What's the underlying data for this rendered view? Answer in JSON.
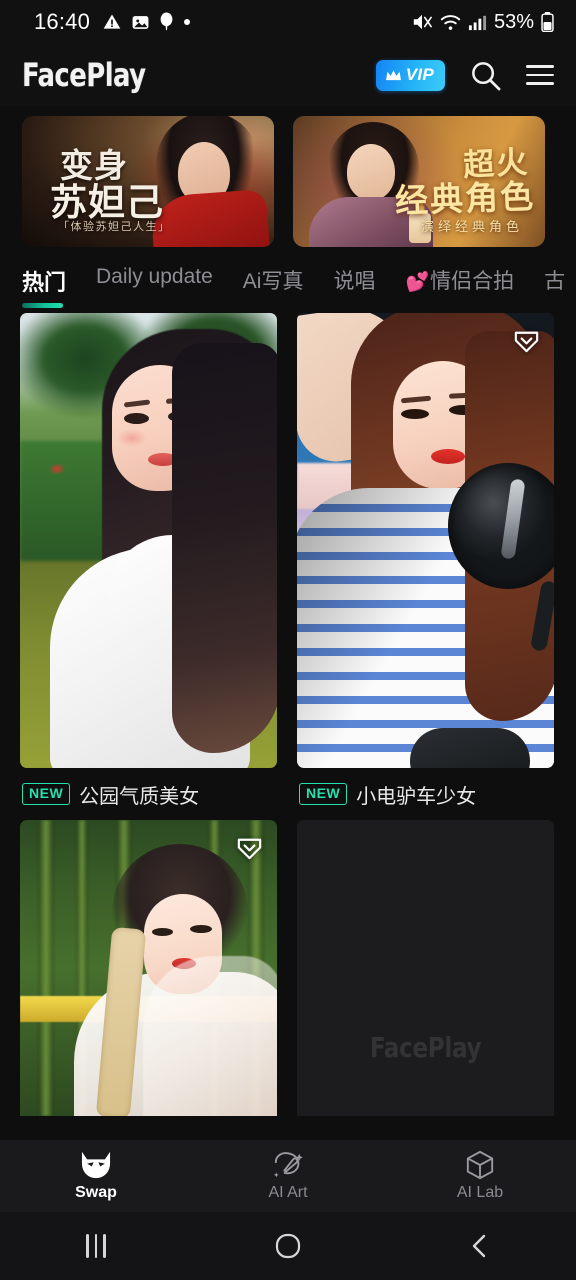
{
  "status_bar": {
    "clock": "16:40",
    "left_icons": [
      "warning-triangle-icon",
      "image-icon",
      "balloon-icon",
      "dot-icon"
    ],
    "right_icons": [
      "mute-icon",
      "wifi-icon",
      "cellular-signal-icon"
    ],
    "battery_percent": "53%"
  },
  "header": {
    "logo": "FacePlay",
    "vip_label": "VIP",
    "icons": [
      "crown-icon",
      "search-icon",
      "hamburger-menu-icon"
    ]
  },
  "banners": [
    {
      "title_line1": "变身",
      "title_line2": "苏妲己",
      "subtitle": "「体验苏妲己人生」"
    },
    {
      "title_line1": "超火",
      "title_line2": "经典角色",
      "subtitle": "演绎经典角色"
    }
  ],
  "tabs": [
    {
      "label": "热门",
      "active": true
    },
    {
      "label": "Daily update",
      "active": false
    },
    {
      "label": "Ai写真",
      "active": false
    },
    {
      "label": "说唱",
      "active": false
    },
    {
      "emoji": "💕",
      "label": "情侣合拍",
      "active": false
    },
    {
      "label": "古",
      "active": false
    }
  ],
  "cards": [
    {
      "badge": "NEW",
      "title": "公园气质美女",
      "favorited": false,
      "favorite_icon": ""
    },
    {
      "badge": "NEW",
      "title": "小电驴车少女",
      "favorited": false,
      "favorite_icon": "heart-outline-icon"
    },
    {
      "badge": "",
      "title": "",
      "favorited": false,
      "favorite_icon": "heart-outline-icon"
    },
    {
      "badge": "",
      "title": "",
      "placeholder_watermark": "FacePlay"
    }
  ],
  "bottom_nav": [
    {
      "label": "Swap",
      "icon": "cat-mask-icon",
      "active": true
    },
    {
      "label": "AI Art",
      "icon": "paint-brush-sparkle-icon",
      "active": false
    },
    {
      "label": "AI Lab",
      "icon": "cube-icon",
      "active": false
    }
  ],
  "android_nav": [
    "recents-icon",
    "home-icon",
    "back-icon"
  ],
  "colors": {
    "background": "#0e0e0e",
    "surface": "#111111",
    "accent_teal": "#27e0b0",
    "vip_blue": "#1a8cf5",
    "text_primary": "#ffffff",
    "text_secondary": "#8d8d93"
  }
}
